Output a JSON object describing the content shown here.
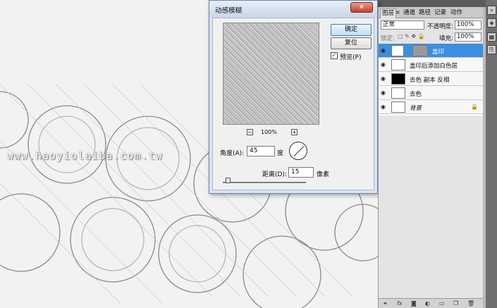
{
  "watermark": "www.haoyiolaiba.com.tw",
  "dialog": {
    "title": "动感模糊",
    "close_icon": "close-icon",
    "ok_label": "确定",
    "reset_label": "复位",
    "preview_label": "预览(P)",
    "preview_checked": true,
    "zoom_out": "−",
    "zoom_in": "+",
    "zoom_pct": "100%",
    "angle_label": "角度(A):",
    "angle_value": "45",
    "angle_unit": "度",
    "distance_label": "距离(D):",
    "distance_value": "15",
    "distance_unit": "像素",
    "distance_slider_fraction": 0.05
  },
  "panel": {
    "tabs": [
      "图层",
      "通道",
      "路径",
      "记录",
      "动作"
    ],
    "tab_close": "×",
    "blend_mode": "正常",
    "opacity_label": "不透明度:",
    "opacity_value": "100%",
    "lock_label": "锁定:",
    "fill_label": "填充:",
    "fill_value": "100%",
    "layers": [
      {
        "name": "盖印",
        "selected": true
      },
      {
        "name": "盖印后添加白色层",
        "selected": false
      },
      {
        "name": "去色 副本 反相",
        "selected": false
      },
      {
        "name": "去色",
        "selected": false
      },
      {
        "name": "背景",
        "selected": false,
        "locked": true
      }
    ],
    "bottom_icons": [
      "link-icon",
      "fx-icon",
      "mask-icon",
      "adjustment-icon",
      "group-icon",
      "new-layer-icon",
      "trash-icon"
    ]
  },
  "colors": {
    "selected_layer": "#3b8fe0",
    "dialog_frame": "#d9e4f2"
  }
}
